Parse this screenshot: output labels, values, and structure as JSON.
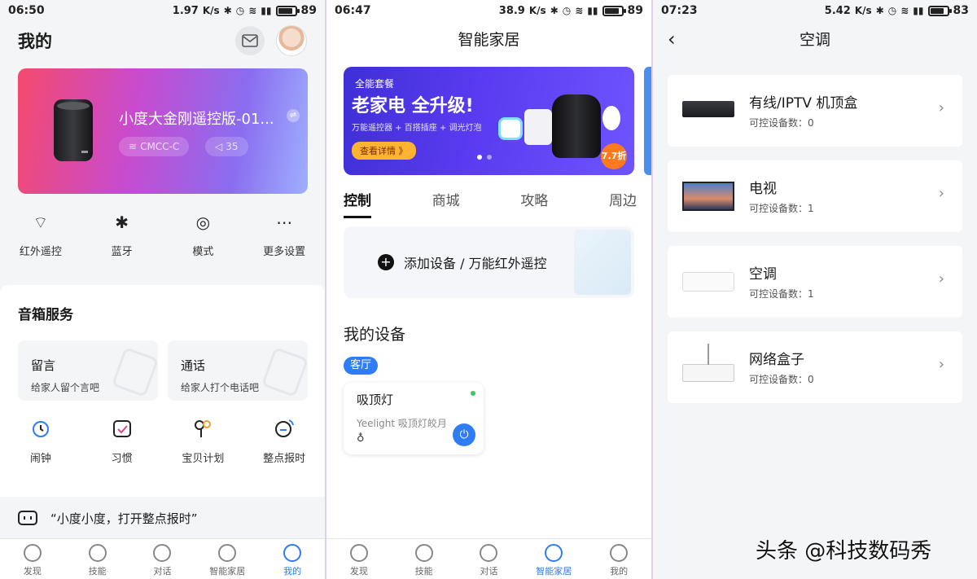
{
  "screen1": {
    "status": {
      "time": "06:50",
      "speed": "1.97",
      "speed_unit": "K/s",
      "battery": "89",
      "battery_level": 0.89
    },
    "title": "我的",
    "device": {
      "name": "小度大金刚遥控版-01...",
      "wifi": "CMCC-C",
      "volume": "35"
    },
    "quick": [
      {
        "label": "红外遥控",
        "icon": "ir-remote-icon"
      },
      {
        "label": "蓝牙",
        "icon": "bluetooth-icon"
      },
      {
        "label": "模式",
        "icon": "mode-icon"
      },
      {
        "label": "更多设置",
        "icon": "more-settings-icon"
      }
    ],
    "section_title": "音箱服务",
    "services": [
      {
        "title": "留言",
        "sub": "给家人留个言吧"
      },
      {
        "title": "通话",
        "sub": "给家人打个电话吧"
      }
    ],
    "grid": [
      {
        "label": "闹钟",
        "icon": "alarm-icon",
        "color": "#2e7cf6"
      },
      {
        "label": "习惯",
        "icon": "habit-icon",
        "color": "#e0457b"
      },
      {
        "label": "宝贝计划",
        "icon": "baby-plan-icon",
        "color": "#f0a030"
      },
      {
        "label": "整点报时",
        "icon": "chime-icon",
        "color": "#2e7cf6"
      }
    ],
    "voice_hint": "“小度小度，打开整点报时”",
    "tabs": [
      "发现",
      "技能",
      "对话",
      "智能家居",
      "我的"
    ],
    "active_tab": 4
  },
  "screen2": {
    "status": {
      "time": "06:47",
      "speed": "38.9",
      "speed_unit": "K/s",
      "battery": "89",
      "battery_level": 0.89
    },
    "title": "智能家居",
    "banner": {
      "tag": "全能套餐",
      "headline": "老家电 全升级!",
      "sub": "万能遥控器 + 百搭插座 + 调光灯泡",
      "cta": "查看详情 》",
      "badge": "7.7折"
    },
    "tabs": [
      "控制",
      "商城",
      "攻略",
      "周边"
    ],
    "active_tab": 0,
    "add_label": "添加设备 / 万能红外遥控",
    "my_devices": "我的设备",
    "room": "客厅",
    "device": {
      "name": "吸顶灯",
      "model": "Yeelight 吸顶灯皎月"
    },
    "bottom_tabs": [
      "发现",
      "技能",
      "对话",
      "智能家居",
      "我的"
    ],
    "bottom_active": 3
  },
  "screen3": {
    "status": {
      "time": "07:23",
      "speed": "5.42",
      "speed_unit": "K/s",
      "battery": "83",
      "battery_level": 0.83
    },
    "title": "空调",
    "items": [
      {
        "name": "有线/IPTV 机顶盒",
        "count": "可控设备数：0"
      },
      {
        "name": "电视",
        "count": "可控设备数：1"
      },
      {
        "name": "空调",
        "count": "可控设备数：1"
      },
      {
        "name": "网络盒子",
        "count": "可控设备数：0"
      }
    ]
  },
  "watermark": "头条 @科技数码秀",
  "colors": {
    "accent": "#2e7cf6",
    "online": "#3cc767"
  }
}
